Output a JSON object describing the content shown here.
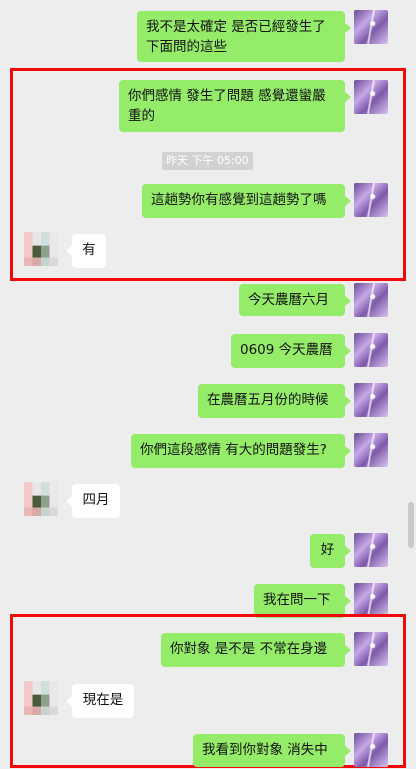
{
  "messages": [
    {
      "side": "self",
      "text": "我不是太確定 是否已經發生了下面問的這些"
    },
    {
      "side": "self",
      "text": "你們感情 發生了問題 感覺還蠻嚴重的"
    },
    {
      "side": "self",
      "text": "這趟勢你有感覺到這趟勢了嗎"
    },
    {
      "side": "other",
      "text": "有"
    },
    {
      "side": "self",
      "text": "今天農曆六月"
    },
    {
      "side": "self",
      "text": "0609 今天農曆"
    },
    {
      "side": "self",
      "text": "在農曆五月份的時候"
    },
    {
      "side": "self",
      "text": "你們這段感情 有大的問題發生?"
    },
    {
      "side": "other",
      "text": "四月"
    },
    {
      "side": "self",
      "text": "好"
    },
    {
      "side": "self",
      "text": "我在問一下"
    },
    {
      "side": "self",
      "text": "你對象 是不是 不常在身邊"
    },
    {
      "side": "other",
      "text": "現在是"
    },
    {
      "side": "self",
      "text": "我看到你對象 消失中"
    }
  ],
  "timestamp": "昨天 下午 05:00",
  "colors": {
    "self_bubble": "#95ec69",
    "other_bubble": "#ffffff",
    "highlight": "#f20a0a",
    "background": "#ededed"
  }
}
